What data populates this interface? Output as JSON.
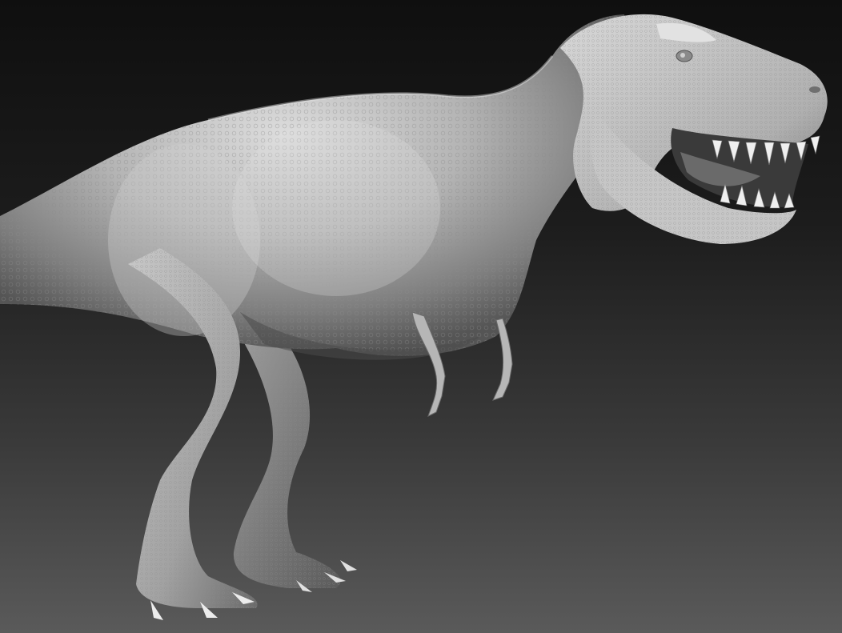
{
  "scene": {
    "subject": "tyrannosaurus-sculpt",
    "material": "clay-grey",
    "colors": {
      "background_top": "#0f0f0f",
      "background_bottom": "#5a5a5a",
      "clay_light": "#d4d4d4",
      "clay_mid": "#a8a8a8",
      "clay_shadow": "#5e5e5e",
      "mouth_interior": "#3a3a3a",
      "teeth": "#efefef"
    }
  }
}
